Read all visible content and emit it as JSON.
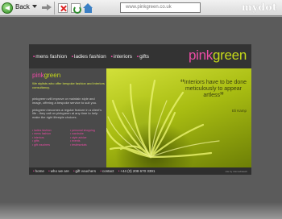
{
  "browser": {
    "back_label": "Back",
    "address": "www.pinkgreen.co.uk",
    "brand": "mydot"
  },
  "site": {
    "nav": [
      {
        "label": "mens fashion"
      },
      {
        "label": "ladies fashion"
      },
      {
        "label": "interiors"
      },
      {
        "label": "gifts"
      }
    ],
    "logo_pink": "pink",
    "logo_green": "green",
    "sidebar": {
      "logo_pink": "pink",
      "logo_green": "green",
      "intro_highlight": "We stylists who offer bespoke fashion and interiors consultancy.",
      "paragraph_1": "pinkgreen will improve or maintain style and image, offering a bespoke service to suit you.",
      "paragraph_2": "pinkgreen becomes a regular feature in a client's life - they call on pinkgreen at any time to help make the right lifestyle choices.",
      "links_left": [
        "• ladies fashion",
        "• mens fashion",
        "• interiors",
        "• gifts",
        "• gift vouchers"
      ],
      "links_right": [
        "• personal shopping",
        "• wardrobe",
        "• style advice",
        "• events",
        "• testimonials"
      ]
    },
    "quote": {
      "text": "Interiors have to be done meticulously to appear artless",
      "open_mark": "“",
      "close_mark": "”",
      "author": "Eli Kamp"
    },
    "footer": {
      "links": [
        {
          "label": "home"
        },
        {
          "label": "who we are"
        },
        {
          "label": "gift vouchers"
        },
        {
          "label": "contact"
        },
        {
          "label": "+44 (0) 208 670 3391"
        }
      ],
      "credit": "site by dotmediaweb"
    }
  },
  "colors": {
    "accent_pink": "#ec4ca5",
    "accent_green": "#c6d91a",
    "page_bg": "#5b5b5b"
  },
  "icons": [
    "back-icon",
    "chevron-down-icon",
    "forward-icon",
    "stop-icon",
    "refresh-icon",
    "home-icon"
  ]
}
